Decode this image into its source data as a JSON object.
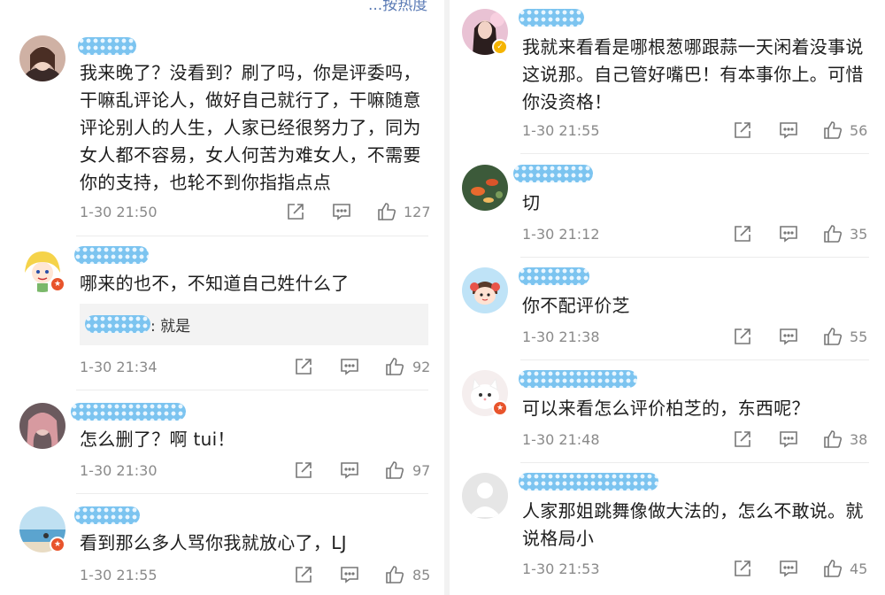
{
  "top_link": "...按热度",
  "left_column": [
    {
      "text": "我来晚了？没看到？刷了吗，你是评委吗，干嘛乱评论人，做好自己就行了，干嘛随意评论别人的人生，人家已经很努力了，同为女人都不容易，女人何苦为难女人，不需要你的支持，也轮不到你指指点点",
      "time": "1-30 21:50",
      "likes": "127"
    },
    {
      "text": "哪来的也不，不知道自己姓什么了",
      "reply_text": ": 就是",
      "time": "1-30 21:34",
      "likes": "92"
    },
    {
      "text": "怎么删了？啊 tui！",
      "time": "1-30 21:30",
      "likes": "97"
    },
    {
      "text": "看到那么多人骂你我就放心了，LJ",
      "time": "1-30 21:55",
      "likes": "85"
    }
  ],
  "right_column": [
    {
      "text": "我就来看看是哪根葱哪跟蒜一天闲着没事说这说那。自己管好嘴巴！有本事你上。可惜你没资格！",
      "time": "1-30 21:55",
      "likes": "56"
    },
    {
      "text": "切",
      "time": "1-30 21:12",
      "likes": "35"
    },
    {
      "text": "你不配评价芝",
      "time": "1-30 21:38",
      "likes": "55"
    },
    {
      "text": "可以来看怎么评价柏芝的，东西呢？",
      "time": "1-30 21:48",
      "likes": "38"
    },
    {
      "text": "人家那姐跳舞像做大法的，怎么不敢说。就说格局小",
      "time": "1-30 21:53",
      "likes": "45"
    }
  ],
  "icons": {
    "share": "share-icon",
    "comment": "comment-icon",
    "like": "thumbs-up-icon"
  },
  "colors": {
    "username_mask": "#7cc4f0",
    "badge_red": "#e8542c",
    "badge_gold": "#f5b400",
    "meta_gray": "#8a8a8a"
  }
}
